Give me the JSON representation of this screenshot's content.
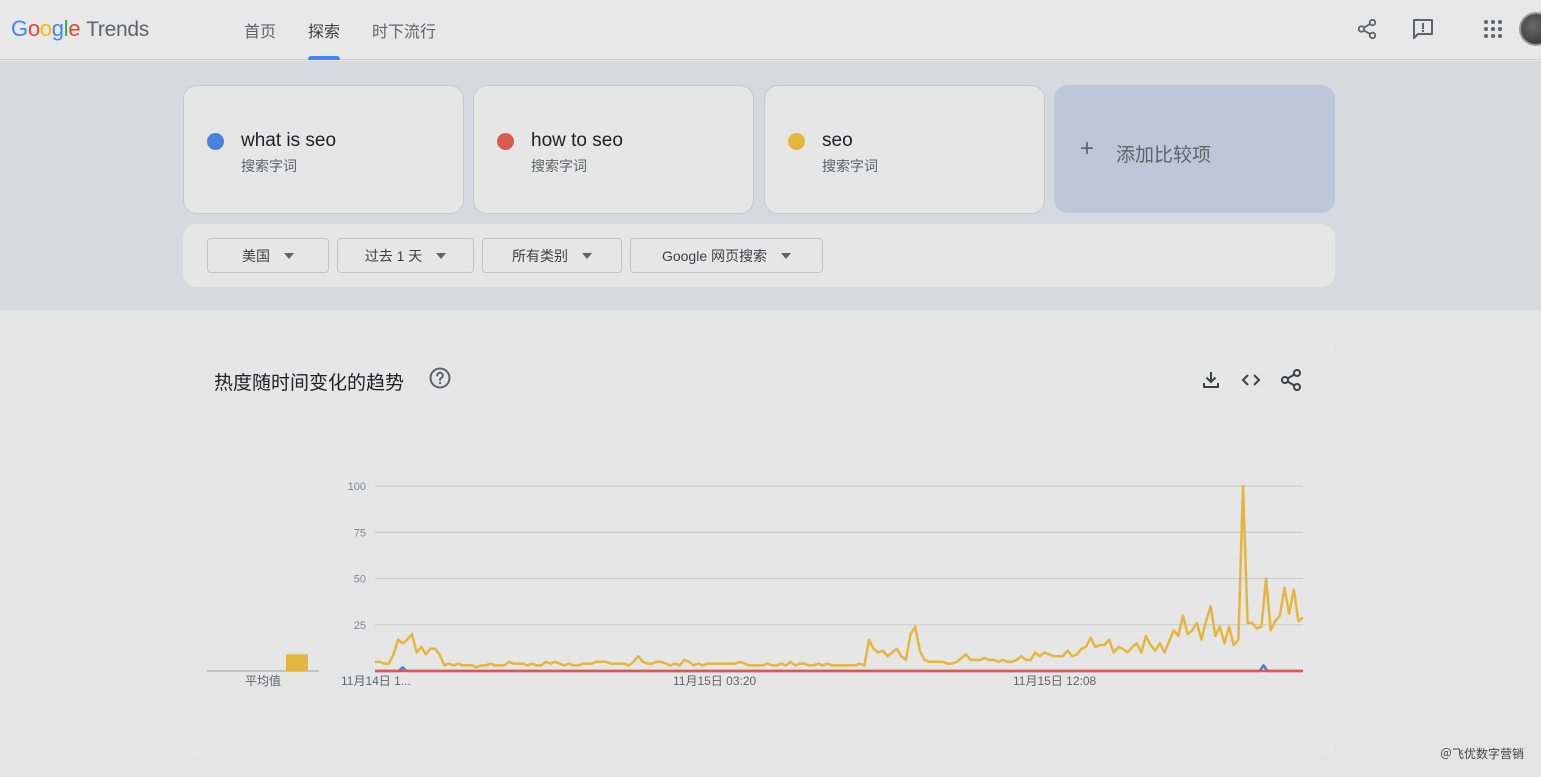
{
  "header": {
    "logo_google": [
      "G",
      "o",
      "o",
      "g",
      "l",
      "e"
    ],
    "logo_trends": "Trends",
    "nav": [
      {
        "label": "首页"
      },
      {
        "label": "探索"
      },
      {
        "label": "时下流行"
      }
    ]
  },
  "terms": [
    {
      "name": "what is seo",
      "sub": "搜索字词",
      "color": "#4a80e0"
    },
    {
      "name": "how to seo",
      "sub": "搜索字词",
      "color": "#db5a4e"
    },
    {
      "name": "seo",
      "sub": "搜索字词",
      "color": "#e3b73f"
    }
  ],
  "add_compare": {
    "plus": "+",
    "label": "添加比较项"
  },
  "filters": [
    "美国",
    "过去 1 天",
    "所有类别",
    "Google 网页搜索"
  ],
  "chart_card": {
    "title": "热度随时间变化的趋势",
    "average_label": "平均值"
  },
  "chart_data": {
    "type": "line",
    "ylim": [
      0,
      100
    ],
    "yticks": [
      25,
      50,
      75,
      100
    ],
    "x_tick_labels": [
      "11月14日 1...",
      "11月15日 03:20",
      "11月15日 12:08"
    ],
    "grid": true,
    "series": [
      {
        "name": "what is seo",
        "color": "#4a80e0",
        "values": [
          0,
          0,
          0,
          0,
          0,
          0,
          0,
          2,
          0,
          0,
          0,
          0,
          0,
          0,
          0,
          0,
          0,
          0,
          0,
          0,
          0,
          0,
          0,
          0,
          0,
          0,
          0,
          0,
          0,
          0,
          0,
          0,
          0,
          0,
          0,
          0,
          0,
          0,
          0,
          0,
          0,
          0,
          0,
          0,
          0,
          0,
          0,
          0,
          0,
          0,
          0,
          0,
          0,
          0,
          0,
          0,
          0,
          0,
          0,
          0,
          0,
          0,
          0,
          0,
          0,
          0,
          0,
          0,
          0,
          0,
          0,
          0,
          0,
          0,
          0,
          0,
          0,
          0,
          0,
          0,
          0,
          0,
          0,
          0,
          0,
          0,
          0,
          0,
          0,
          0,
          0,
          0,
          0,
          0,
          0,
          0,
          0,
          0,
          0,
          0,
          0,
          0,
          0,
          0,
          0,
          0,
          0,
          0,
          0,
          0,
          0,
          0,
          0,
          0,
          0,
          0,
          0,
          0,
          0,
          0,
          0,
          0,
          0,
          0,
          0,
          0,
          0,
          0,
          0,
          0,
          0,
          0,
          0,
          0,
          0,
          0,
          0,
          0,
          0,
          0,
          0,
          0,
          0,
          0,
          0,
          0,
          0,
          0,
          0,
          0,
          0,
          0,
          0,
          0,
          0,
          0,
          0,
          0,
          0,
          0,
          0,
          0,
          0,
          0,
          0,
          0,
          0,
          0,
          0,
          0,
          0,
          0,
          0,
          0,
          0,
          0,
          0,
          0,
          0,
          0,
          0,
          0,
          0,
          0,
          0,
          0,
          0,
          0,
          0,
          0,
          0,
          0,
          0,
          0,
          0,
          0,
          0,
          0,
          0,
          0,
          0,
          0,
          0,
          0,
          0,
          0,
          0,
          0,
          0,
          0,
          0,
          0,
          0,
          0,
          0,
          0,
          0,
          0,
          0,
          0,
          0,
          0,
          0,
          0,
          0,
          3,
          0,
          0,
          0,
          0,
          0,
          0,
          0,
          0,
          0,
          0
        ]
      },
      {
        "name": "how to seo",
        "color": "#db5a4e",
        "values": [
          0,
          0,
          0,
          0,
          0,
          0,
          0,
          0,
          0,
          0,
          0,
          0,
          0,
          0,
          0,
          0,
          0,
          0,
          0,
          0,
          0,
          0,
          0,
          0,
          0,
          0,
          0,
          0,
          0,
          0,
          0,
          0,
          0,
          0,
          0,
          0,
          0,
          0,
          0,
          0,
          0,
          0,
          0,
          0,
          0,
          0,
          0,
          0,
          0,
          0,
          0,
          0,
          0,
          0,
          0,
          0,
          0,
          0,
          0,
          0,
          0,
          0,
          0,
          0,
          0,
          0,
          0,
          0,
          0,
          0,
          0,
          0,
          0,
          0,
          0,
          0,
          0,
          0,
          0,
          0,
          0,
          0,
          0,
          0,
          0,
          0,
          0,
          0,
          0,
          0,
          0,
          0,
          0,
          0,
          0,
          0,
          0,
          0,
          0,
          0,
          0,
          0,
          0,
          0,
          0,
          0,
          0,
          0,
          0,
          0,
          0,
          0,
          0,
          0,
          0,
          0,
          0,
          0,
          0,
          0,
          0,
          0,
          0,
          0,
          0,
          0,
          0,
          0,
          0,
          0,
          0,
          0,
          0,
          0,
          0,
          0,
          0,
          0,
          0,
          0,
          0,
          0,
          0,
          0,
          0,
          0,
          0,
          0,
          0,
          0,
          0,
          0,
          0,
          0,
          0,
          0,
          0,
          0,
          0,
          0,
          0,
          0,
          0,
          0,
          0,
          0,
          0,
          0,
          0,
          0,
          0,
          0,
          0,
          0,
          0,
          0,
          0,
          0,
          0,
          0,
          0,
          0,
          0,
          0,
          0,
          0,
          0,
          0,
          0,
          0,
          0,
          0,
          0,
          0,
          0,
          0,
          0,
          0,
          0,
          0,
          0,
          0,
          0,
          0,
          0,
          0,
          0,
          0,
          0,
          0,
          0,
          0,
          0,
          0,
          0,
          0,
          0,
          0,
          0,
          0,
          0,
          0,
          0,
          0,
          0,
          0,
          0,
          0,
          0,
          0,
          0,
          0,
          0,
          0,
          0,
          0
        ]
      },
      {
        "name": "seo",
        "color": "#e3b73f",
        "values": [
          5,
          5,
          4,
          4,
          9,
          17,
          15,
          17,
          20,
          10,
          13,
          9,
          12,
          12,
          9,
          3,
          4,
          3,
          4,
          3,
          3,
          3,
          2,
          3,
          3,
          4,
          3,
          3,
          3,
          5,
          4,
          4,
          4,
          3,
          4,
          3,
          3,
          5,
          4,
          5,
          4,
          3,
          4,
          3,
          3,
          4,
          4,
          4,
          5,
          5,
          5,
          4,
          4,
          4,
          4,
          3,
          5,
          8,
          5,
          4,
          4,
          5,
          5,
          4,
          3,
          4,
          3,
          6,
          5,
          3,
          4,
          3,
          4,
          4,
          4,
          4,
          4,
          4,
          4,
          5,
          4,
          3,
          3,
          3,
          3,
          4,
          3,
          3,
          4,
          3,
          5,
          3,
          4,
          4,
          3,
          3,
          4,
          3,
          4,
          3,
          3,
          3,
          3,
          3,
          3,
          4,
          3,
          17,
          12,
          10,
          11,
          8,
          10,
          12,
          8,
          6,
          20,
          24,
          11,
          6,
          5,
          5,
          5,
          5,
          4,
          4,
          5,
          7,
          9,
          6,
          6,
          6,
          7,
          6,
          6,
          5,
          6,
          5,
          5,
          6,
          8,
          6,
          6,
          10,
          8,
          10,
          9,
          8,
          8,
          8,
          11,
          8,
          9,
          12,
          13,
          18,
          13,
          14,
          14,
          17,
          10,
          13,
          12,
          10,
          13,
          15,
          10,
          19,
          14,
          11,
          15,
          10,
          16,
          22,
          19,
          30,
          20,
          22,
          26,
          17,
          27,
          35,
          19,
          24,
          15,
          24,
          14,
          17,
          100,
          26,
          26,
          23,
          24,
          50,
          22,
          27,
          30,
          45,
          31,
          44,
          27,
          29
        ]
      }
    ],
    "average": {
      "values": [
        0,
        0,
        9
      ],
      "colors": [
        "#4a80e0",
        "#db5a4e",
        "#e3b73f"
      ]
    }
  },
  "watermark": "＠飞优数字营销"
}
